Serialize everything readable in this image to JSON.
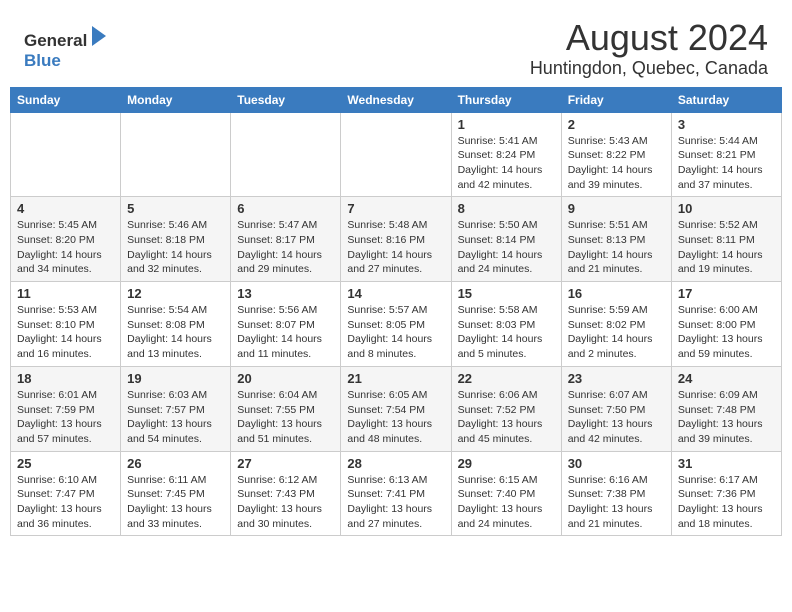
{
  "header": {
    "logo_general": "General",
    "logo_blue": "Blue",
    "title": "August 2024",
    "subtitle": "Huntingdon, Quebec, Canada"
  },
  "calendar": {
    "days_of_week": [
      "Sunday",
      "Monday",
      "Tuesday",
      "Wednesday",
      "Thursday",
      "Friday",
      "Saturday"
    ],
    "weeks": [
      [
        {
          "day": "",
          "info": ""
        },
        {
          "day": "",
          "info": ""
        },
        {
          "day": "",
          "info": ""
        },
        {
          "day": "",
          "info": ""
        },
        {
          "day": "1",
          "info": "Sunrise: 5:41 AM\nSunset: 8:24 PM\nDaylight: 14 hours\nand 42 minutes."
        },
        {
          "day": "2",
          "info": "Sunrise: 5:43 AM\nSunset: 8:22 PM\nDaylight: 14 hours\nand 39 minutes."
        },
        {
          "day": "3",
          "info": "Sunrise: 5:44 AM\nSunset: 8:21 PM\nDaylight: 14 hours\nand 37 minutes."
        }
      ],
      [
        {
          "day": "4",
          "info": "Sunrise: 5:45 AM\nSunset: 8:20 PM\nDaylight: 14 hours\nand 34 minutes."
        },
        {
          "day": "5",
          "info": "Sunrise: 5:46 AM\nSunset: 8:18 PM\nDaylight: 14 hours\nand 32 minutes."
        },
        {
          "day": "6",
          "info": "Sunrise: 5:47 AM\nSunset: 8:17 PM\nDaylight: 14 hours\nand 29 minutes."
        },
        {
          "day": "7",
          "info": "Sunrise: 5:48 AM\nSunset: 8:16 PM\nDaylight: 14 hours\nand 27 minutes."
        },
        {
          "day": "8",
          "info": "Sunrise: 5:50 AM\nSunset: 8:14 PM\nDaylight: 14 hours\nand 24 minutes."
        },
        {
          "day": "9",
          "info": "Sunrise: 5:51 AM\nSunset: 8:13 PM\nDaylight: 14 hours\nand 21 minutes."
        },
        {
          "day": "10",
          "info": "Sunrise: 5:52 AM\nSunset: 8:11 PM\nDaylight: 14 hours\nand 19 minutes."
        }
      ],
      [
        {
          "day": "11",
          "info": "Sunrise: 5:53 AM\nSunset: 8:10 PM\nDaylight: 14 hours\nand 16 minutes."
        },
        {
          "day": "12",
          "info": "Sunrise: 5:54 AM\nSunset: 8:08 PM\nDaylight: 14 hours\nand 13 minutes."
        },
        {
          "day": "13",
          "info": "Sunrise: 5:56 AM\nSunset: 8:07 PM\nDaylight: 14 hours\nand 11 minutes."
        },
        {
          "day": "14",
          "info": "Sunrise: 5:57 AM\nSunset: 8:05 PM\nDaylight: 14 hours\nand 8 minutes."
        },
        {
          "day": "15",
          "info": "Sunrise: 5:58 AM\nSunset: 8:03 PM\nDaylight: 14 hours\nand 5 minutes."
        },
        {
          "day": "16",
          "info": "Sunrise: 5:59 AM\nSunset: 8:02 PM\nDaylight: 14 hours\nand 2 minutes."
        },
        {
          "day": "17",
          "info": "Sunrise: 6:00 AM\nSunset: 8:00 PM\nDaylight: 13 hours\nand 59 minutes."
        }
      ],
      [
        {
          "day": "18",
          "info": "Sunrise: 6:01 AM\nSunset: 7:59 PM\nDaylight: 13 hours\nand 57 minutes."
        },
        {
          "day": "19",
          "info": "Sunrise: 6:03 AM\nSunset: 7:57 PM\nDaylight: 13 hours\nand 54 minutes."
        },
        {
          "day": "20",
          "info": "Sunrise: 6:04 AM\nSunset: 7:55 PM\nDaylight: 13 hours\nand 51 minutes."
        },
        {
          "day": "21",
          "info": "Sunrise: 6:05 AM\nSunset: 7:54 PM\nDaylight: 13 hours\nand 48 minutes."
        },
        {
          "day": "22",
          "info": "Sunrise: 6:06 AM\nSunset: 7:52 PM\nDaylight: 13 hours\nand 45 minutes."
        },
        {
          "day": "23",
          "info": "Sunrise: 6:07 AM\nSunset: 7:50 PM\nDaylight: 13 hours\nand 42 minutes."
        },
        {
          "day": "24",
          "info": "Sunrise: 6:09 AM\nSunset: 7:48 PM\nDaylight: 13 hours\nand 39 minutes."
        }
      ],
      [
        {
          "day": "25",
          "info": "Sunrise: 6:10 AM\nSunset: 7:47 PM\nDaylight: 13 hours\nand 36 minutes."
        },
        {
          "day": "26",
          "info": "Sunrise: 6:11 AM\nSunset: 7:45 PM\nDaylight: 13 hours\nand 33 minutes."
        },
        {
          "day": "27",
          "info": "Sunrise: 6:12 AM\nSunset: 7:43 PM\nDaylight: 13 hours\nand 30 minutes."
        },
        {
          "day": "28",
          "info": "Sunrise: 6:13 AM\nSunset: 7:41 PM\nDaylight: 13 hours\nand 27 minutes."
        },
        {
          "day": "29",
          "info": "Sunrise: 6:15 AM\nSunset: 7:40 PM\nDaylight: 13 hours\nand 24 minutes."
        },
        {
          "day": "30",
          "info": "Sunrise: 6:16 AM\nSunset: 7:38 PM\nDaylight: 13 hours\nand 21 minutes."
        },
        {
          "day": "31",
          "info": "Sunrise: 6:17 AM\nSunset: 7:36 PM\nDaylight: 13 hours\nand 18 minutes."
        }
      ]
    ]
  }
}
